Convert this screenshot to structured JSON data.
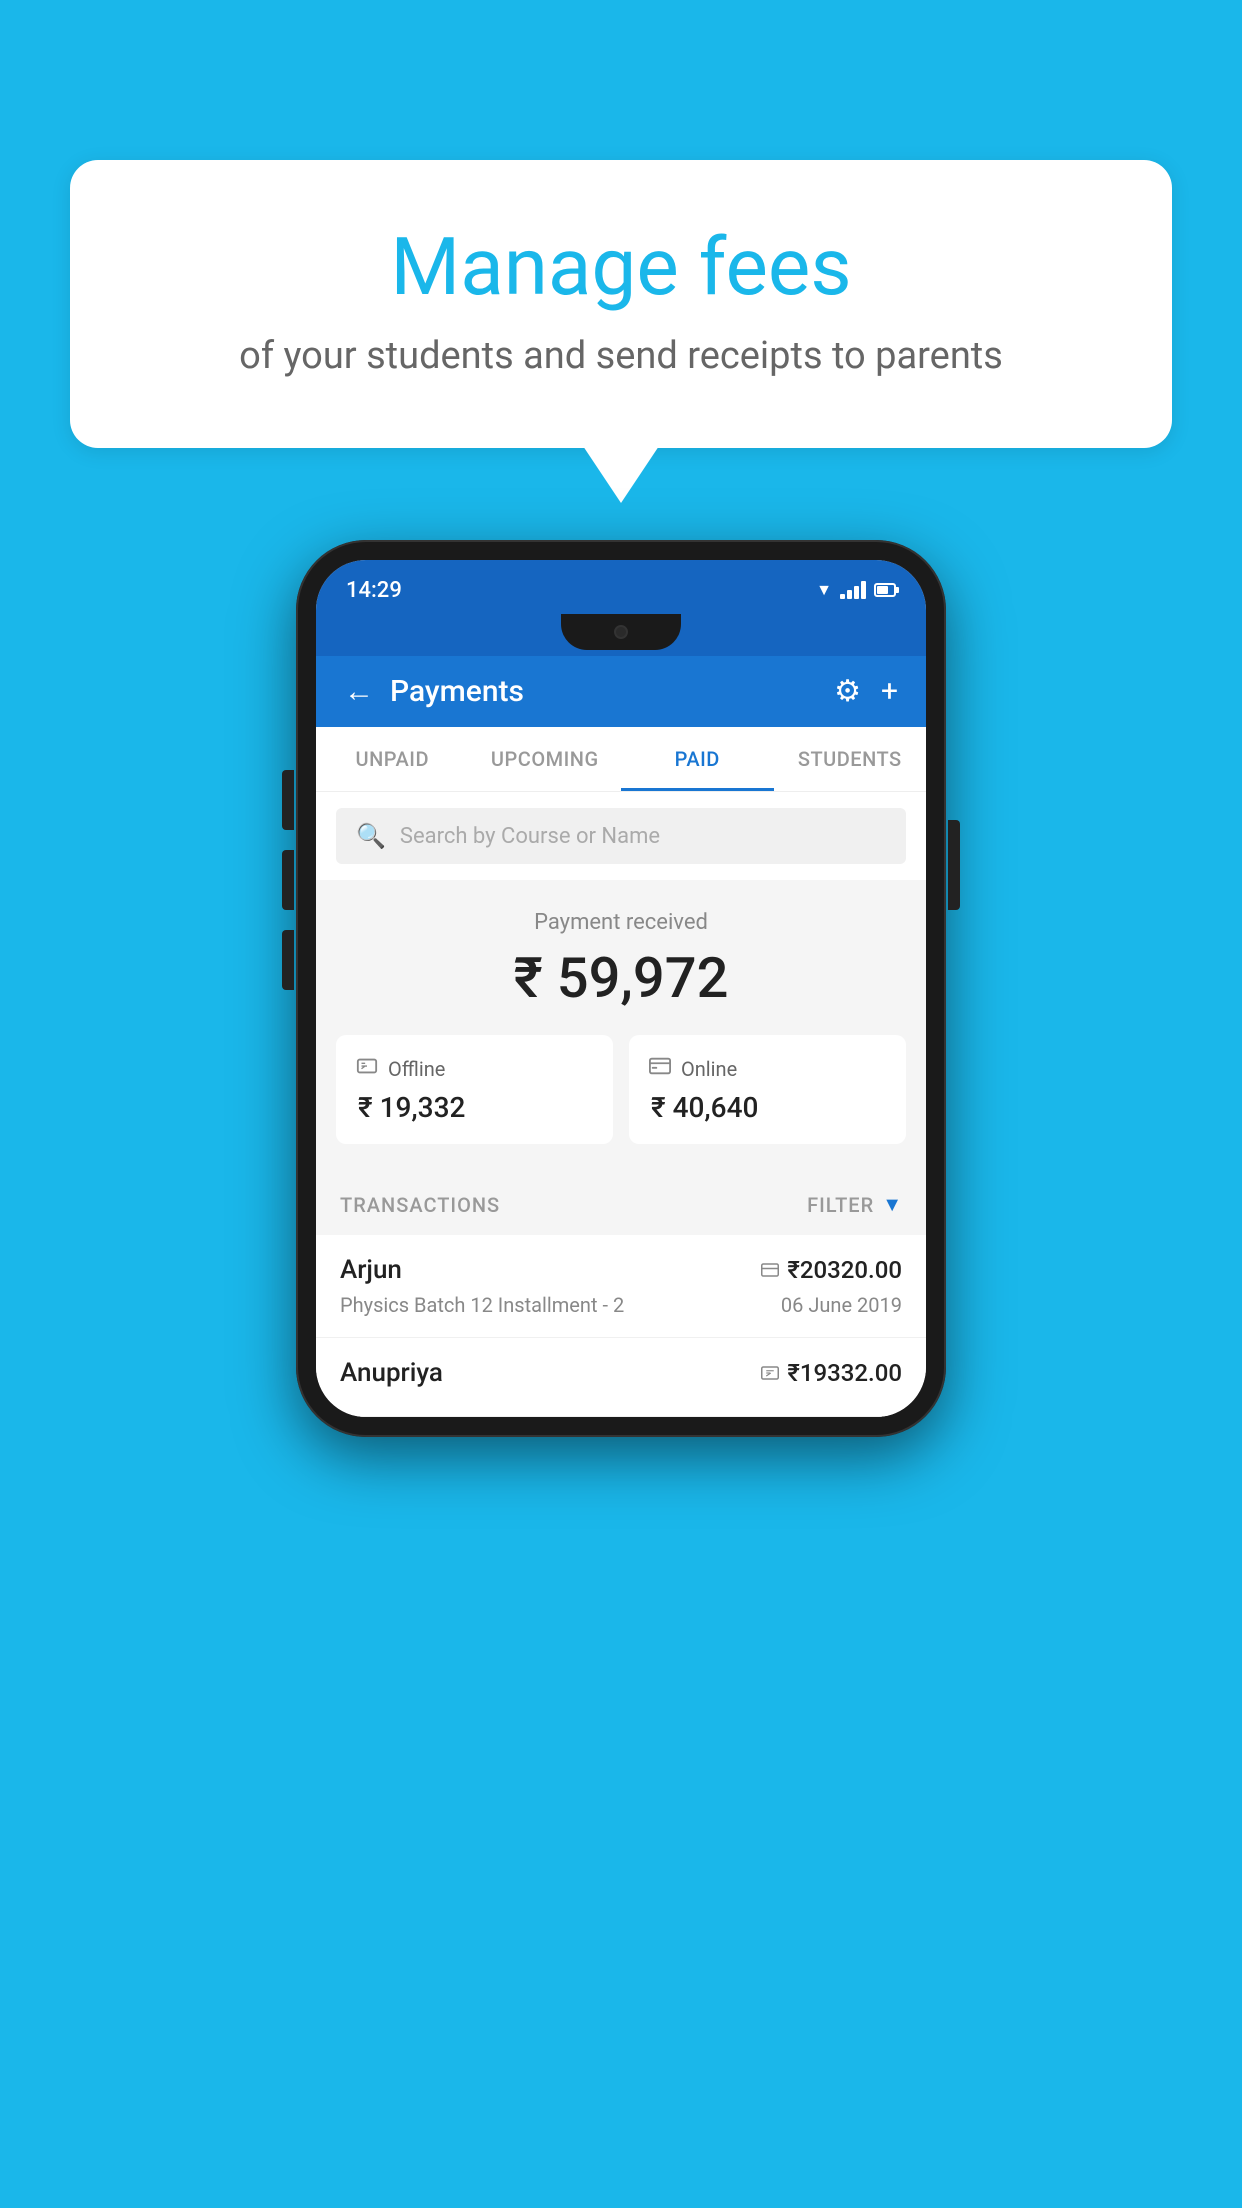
{
  "background_color": "#1ab7ea",
  "bubble": {
    "title": "Manage fees",
    "subtitle": "of your students and send receipts to parents"
  },
  "phone": {
    "status_bar": {
      "time": "14:29"
    },
    "header": {
      "title": "Payments",
      "back_label": "←",
      "settings_label": "⚙",
      "add_label": "+"
    },
    "tabs": [
      {
        "label": "UNPAID",
        "active": false
      },
      {
        "label": "UPCOMING",
        "active": false
      },
      {
        "label": "PAID",
        "active": true
      },
      {
        "label": "STUDENTS",
        "active": false
      }
    ],
    "search": {
      "placeholder": "Search by Course or Name"
    },
    "payment_summary": {
      "label": "Payment received",
      "amount": "₹ 59,972",
      "offline_label": "Offline",
      "offline_amount": "₹ 19,332",
      "online_label": "Online",
      "online_amount": "₹ 40,640"
    },
    "transactions": {
      "header_label": "TRANSACTIONS",
      "filter_label": "FILTER",
      "rows": [
        {
          "name": "Arjun",
          "amount": "₹20320.00",
          "course": "Physics Batch 12 Installment - 2",
          "date": "06 June 2019",
          "payment_type": "online"
        },
        {
          "name": "Anupriya",
          "amount": "₹19332.00",
          "course": "",
          "date": "",
          "payment_type": "offline"
        }
      ]
    }
  }
}
